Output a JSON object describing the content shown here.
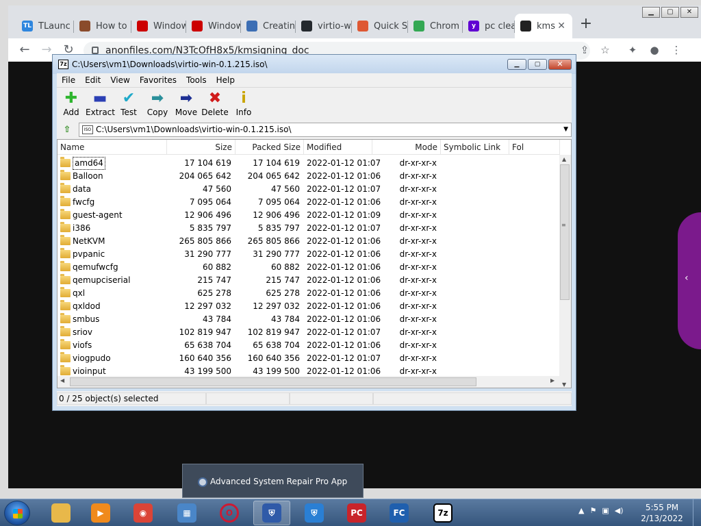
{
  "browser": {
    "tabs": [
      {
        "label": "TLaunc",
        "icon": "tlauncher-icon",
        "color": "#2e86de",
        "glyph": "TL"
      },
      {
        "label": "How to",
        "icon": "howto-icon",
        "color": "#8a4b2b",
        "glyph": ""
      },
      {
        "label": "Window",
        "icon": "redhat-icon",
        "color": "#cc0000",
        "glyph": ""
      },
      {
        "label": "Window",
        "icon": "redhat-icon",
        "color": "#cc0000",
        "glyph": ""
      },
      {
        "label": "Creatin",
        "icon": "fedora-icon",
        "color": "#3c6eb4",
        "glyph": ""
      },
      {
        "label": "virtio-w",
        "icon": "github-icon",
        "color": "#24292e",
        "glyph": ""
      },
      {
        "label": "Quick S",
        "icon": "duckduckgo-icon",
        "color": "#de5833",
        "glyph": ""
      },
      {
        "label": "Chrom",
        "icon": "chrome-icon",
        "color": "#34a853",
        "glyph": ""
      },
      {
        "label": "pc clea",
        "icon": "yahoo-icon",
        "color": "#6001d2",
        "glyph": "y"
      },
      {
        "label": "kms",
        "icon": "anonfiles-icon",
        "color": "#222222",
        "glyph": "",
        "active": true
      }
    ],
    "url": "anonfiles.com/N3TcOfH8x5/kmsigning_doc"
  },
  "sevenzip": {
    "title": "C:\\Users\\vm1\\Downloads\\virtio-win-0.1.215.iso\\",
    "menu": [
      "File",
      "Edit",
      "View",
      "Favorites",
      "Tools",
      "Help"
    ],
    "tools": [
      {
        "label": "Add",
        "icon": "plus-icon",
        "glyph": "✚",
        "color": "#2fb52f"
      },
      {
        "label": "Extract",
        "icon": "minus-icon",
        "glyph": "▬",
        "color": "#2b3fb4"
      },
      {
        "label": "Test",
        "icon": "check-icon",
        "glyph": "✔",
        "color": "#1fa9c9"
      },
      {
        "label": "Copy",
        "icon": "copy-arrow-icon",
        "glyph": "➡",
        "color": "#2a8f9a"
      },
      {
        "label": "Move",
        "icon": "move-arrow-icon",
        "glyph": "➡",
        "color": "#1d2f93"
      },
      {
        "label": "Delete",
        "icon": "delete-x-icon",
        "glyph": "✖",
        "color": "#d01b1b"
      },
      {
        "label": "Info",
        "icon": "info-icon",
        "glyph": "i",
        "color": "#c9a400"
      }
    ],
    "path": "C:\\Users\\vm1\\Downloads\\virtio-win-0.1.215.iso\\",
    "columns": [
      "Name",
      "Size",
      "Packed Size",
      "Modified",
      "Mode",
      "Symbolic Link",
      "Fol"
    ],
    "rows": [
      {
        "name": "amd64",
        "size": "17 104 619",
        "packed": "17 104 619",
        "modified": "2022-01-12 01:07",
        "mode": "dr-xr-xr-x"
      },
      {
        "name": "Balloon",
        "size": "204 065 642",
        "packed": "204 065 642",
        "modified": "2022-01-12 01:06",
        "mode": "dr-xr-xr-x"
      },
      {
        "name": "data",
        "size": "47 560",
        "packed": "47 560",
        "modified": "2022-01-12 01:07",
        "mode": "dr-xr-xr-x"
      },
      {
        "name": "fwcfg",
        "size": "7 095 064",
        "packed": "7 095 064",
        "modified": "2022-01-12 01:06",
        "mode": "dr-xr-xr-x"
      },
      {
        "name": "guest-agent",
        "size": "12 906 496",
        "packed": "12 906 496",
        "modified": "2022-01-12 01:09",
        "mode": "dr-xr-xr-x"
      },
      {
        "name": "i386",
        "size": "5 835 797",
        "packed": "5 835 797",
        "modified": "2022-01-12 01:07",
        "mode": "dr-xr-xr-x"
      },
      {
        "name": "NetKVM",
        "size": "265 805 866",
        "packed": "265 805 866",
        "modified": "2022-01-12 01:06",
        "mode": "dr-xr-xr-x"
      },
      {
        "name": "pvpanic",
        "size": "31 290 777",
        "packed": "31 290 777",
        "modified": "2022-01-12 01:06",
        "mode": "dr-xr-xr-x"
      },
      {
        "name": "qemufwcfg",
        "size": "60 882",
        "packed": "60 882",
        "modified": "2022-01-12 01:06",
        "mode": "dr-xr-xr-x"
      },
      {
        "name": "qemupciserial",
        "size": "215 747",
        "packed": "215 747",
        "modified": "2022-01-12 01:06",
        "mode": "dr-xr-xr-x"
      },
      {
        "name": "qxl",
        "size": "625 278",
        "packed": "625 278",
        "modified": "2022-01-12 01:06",
        "mode": "dr-xr-xr-x"
      },
      {
        "name": "qxldod",
        "size": "12 297 032",
        "packed": "12 297 032",
        "modified": "2022-01-12 01:06",
        "mode": "dr-xr-xr-x"
      },
      {
        "name": "smbus",
        "size": "43 784",
        "packed": "43 784",
        "modified": "2022-01-12 01:06",
        "mode": "dr-xr-xr-x"
      },
      {
        "name": "sriov",
        "size": "102 819 947",
        "packed": "102 819 947",
        "modified": "2022-01-12 01:07",
        "mode": "dr-xr-xr-x"
      },
      {
        "name": "viofs",
        "size": "65 638 704",
        "packed": "65 638 704",
        "modified": "2022-01-12 01:06",
        "mode": "dr-xr-xr-x"
      },
      {
        "name": "viogpudo",
        "size": "160 640 356",
        "packed": "160 640 356",
        "modified": "2022-01-12 01:07",
        "mode": "dr-xr-xr-x"
      },
      {
        "name": "vioinput",
        "size": "43 199 500",
        "packed": "43 199 500",
        "modified": "2022-01-12 01:06",
        "mode": "dr-xr-xr-x"
      }
    ],
    "status": "0 / 25 object(s) selected"
  },
  "notification": {
    "text": "Advanced System Repair Pro App"
  },
  "taskbar": {
    "apps": [
      {
        "name": "explorer",
        "icon": "folder-icon",
        "color": "#e8b84a",
        "glyph": ""
      },
      {
        "name": "media-player",
        "icon": "media-player-icon",
        "color": "#f08a1c",
        "glyph": "▶"
      },
      {
        "name": "chrome",
        "icon": "chrome-icon",
        "color": "#db4437",
        "glyph": "◉"
      },
      {
        "name": "control-panel",
        "icon": "control-panel-icon",
        "color": "#4a86c8",
        "glyph": "▦"
      },
      {
        "name": "opera",
        "icon": "opera-icon",
        "color": "#cc1a33",
        "glyph": "O"
      },
      {
        "name": "security-app",
        "icon": "shield-icon",
        "color": "#2f5aa8",
        "glyph": "⛨",
        "active": true
      },
      {
        "name": "defender",
        "icon": "shield-icon",
        "color": "#2a7fd4",
        "glyph": "⛨"
      },
      {
        "name": "pc-cleaner",
        "icon": "pc-cleaner-icon",
        "color": "#c8242a",
        "glyph": "PC"
      },
      {
        "name": "filecleaner",
        "icon": "filecleaner-icon",
        "color": "#1f5fae",
        "glyph": "FC"
      },
      {
        "name": "7zip",
        "icon": "7zip-icon",
        "color": "#ffffff",
        "glyph": "7z"
      }
    ],
    "time": "5:55 PM",
    "date": "2/13/2022"
  }
}
